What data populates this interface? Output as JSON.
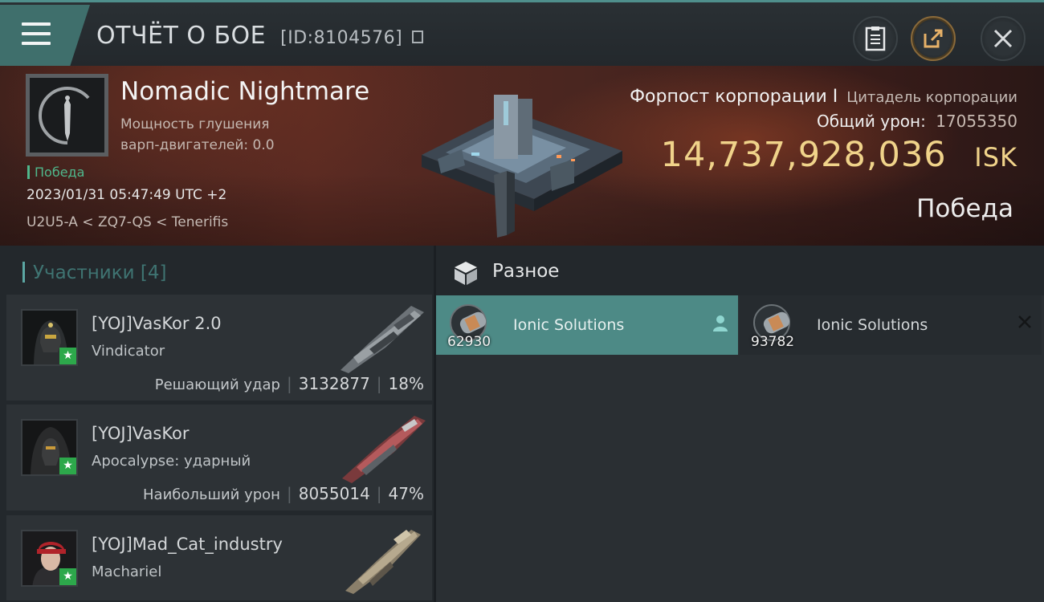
{
  "header": {
    "title": "ОТЧЁТ О БОЕ",
    "id_label": "[ID:8104576]",
    "icons": [
      "menu-icon",
      "report-icon",
      "share-icon",
      "close-icon"
    ]
  },
  "victim": {
    "name": "Nomadic Nightmare",
    "stat_line1": "Мощность глушения",
    "stat_line2": "варп-двигателей: 0.0",
    "tag": "Победа",
    "datetime": "2023/01/31 05:47:49 UTC +2",
    "location": "U2U5-A < ZQ7-QS < Tenerifis"
  },
  "target": {
    "type": "Форпост корпорации I",
    "subtype": "Цитадель корпорации",
    "total_damage_label": "Общий урон:",
    "total_damage_value": "17055350",
    "isk_value": "14,737,928,036",
    "isk_currency": "ISK",
    "result": "Победа"
  },
  "participants": {
    "title": "Участники [4]",
    "items": [
      {
        "name": "[YOJ]VasKor 2.0",
        "ship": "Vindicator",
        "role": "Решающий удар",
        "damage": "3132877",
        "percent": "18%"
      },
      {
        "name": "[YOJ]VasKor",
        "ship": "Apocalypse: ударный",
        "role": "Наибольший урон",
        "damage": "8055014",
        "percent": "47%"
      },
      {
        "name": "[YOJ]Mad_Cat_industry",
        "ship": "Machariel",
        "role": "",
        "damage": "",
        "percent": ""
      }
    ]
  },
  "misc": {
    "title": "Разное",
    "items": [
      {
        "name": "Ionic Solutions",
        "quantity": "62930",
        "selected": true
      },
      {
        "name": "Ionic Solutions",
        "quantity": "93782",
        "selected": false
      }
    ]
  },
  "colors": {
    "accent": "#4d8a86",
    "victory_green": "#4fb88c",
    "isk_gold": "#f0d38a"
  }
}
